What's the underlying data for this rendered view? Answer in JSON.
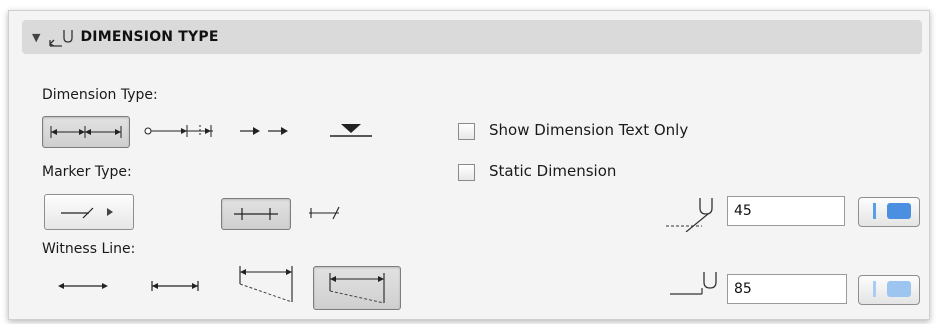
{
  "section": {
    "title": "DIMENSION TYPE",
    "collapse_icon": "triangle-down-icon",
    "icon": "dimension-type-icon"
  },
  "labels": {
    "dimension_type": "Dimension Type:",
    "marker_type": "Marker Type:",
    "witness_line": "Witness Line:"
  },
  "checkboxes": {
    "show_text_only": {
      "label": "Show Dimension Text Only",
      "checked": false
    },
    "static_dimension": {
      "label": "Static Dimension",
      "checked": false
    }
  },
  "fields": {
    "marker_angle": {
      "value": "45"
    },
    "witness_length": {
      "value": "85"
    }
  },
  "colors": {
    "accent": "#4a8fe0",
    "accent_light": "#9cc6f0",
    "header_bg": "#dadada"
  },
  "icons": {
    "dimension_types": [
      "linear-dimension-icon",
      "cumulative-dimension-icon",
      "arrow-chain-icon",
      "elevation-marker-icon"
    ],
    "marker_types": [
      "tick-marker-dropdown-icon",
      "cross-tick-marker-icon",
      "open-tick-marker-icon"
    ],
    "witness_lines": [
      "no-witness-line-icon",
      "short-witness-line-icon",
      "dashed-witness-line-icon",
      "full-witness-line-icon"
    ]
  }
}
